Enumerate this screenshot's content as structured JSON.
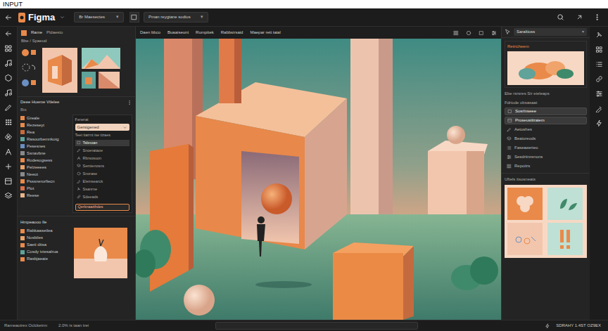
{
  "top_label": "INPUT",
  "title_bar": {
    "logo": "Figma",
    "file_menu": "Br Maesectes",
    "file_caret": "▾",
    "view_menu": "Pman reygtane sodius",
    "view_caret": "▾"
  },
  "canvas_toolbar": {
    "items": [
      "Daen bbco",
      "Buaaiseunt",
      "Rumpttek",
      "Rabbsirsaid",
      "Maepar rett taial"
    ]
  },
  "left_panel": {
    "header": {
      "title": "Rame",
      "subtitle": "Pldaesto"
    },
    "assets": {
      "label": "Bbe / Spaeud"
    },
    "layers": {
      "title": "Deee Hueme Vtlelee",
      "filter": "Bts",
      "items": [
        {
          "label": "Greale",
          "color": "#e98a4a"
        },
        {
          "label": "Rezeseyt",
          "color": "#e98a4a"
        },
        {
          "label": "Rea",
          "color": "#c86b3a"
        },
        {
          "label": "Rasourbemnkotg",
          "color": "#5fa39a"
        },
        {
          "label": "Pesesnes",
          "color": "#6b8fc2"
        },
        {
          "label": "Ssnavbne",
          "color": "#8a8a8a"
        },
        {
          "label": "Rodesogsess",
          "color": "#e98a4a"
        },
        {
          "label": "Pelzeeees",
          "color": "#e9a36a"
        },
        {
          "label": "Neeot",
          "color": "#8a8a8a"
        },
        {
          "label": "Psssnerorfiecn",
          "color": "#e98a4a"
        },
        {
          "label": "Plot",
          "color": "#d9704a"
        },
        {
          "label": "Reese",
          "color": "#e9b48a"
        }
      ]
    },
    "properties": {
      "title": "Fenerat",
      "dropdown": "Gersigened",
      "label": "Teet tiarrnt ise tizaes",
      "items": [
        {
          "label": "Tsbnoan",
          "selected": true
        },
        {
          "label": "Snoerataoe",
          "selected": false
        },
        {
          "label": "Rbrsosuon",
          "selected": false
        },
        {
          "label": "Semtenosns",
          "selected": false
        },
        {
          "label": "Snorase",
          "selected": false
        },
        {
          "label": "Elemsearck",
          "selected": false
        },
        {
          "label": "Ssanrne",
          "selected": false
        },
        {
          "label": "Sdeeads",
          "selected": false
        }
      ],
      "button": "Qerknaatthdes"
    },
    "pages": {
      "title": "Hmpeaooo Ile",
      "items": [
        {
          "label": "Rabkaasetlea",
          "color": "#e98a4a"
        },
        {
          "label": "Nosbiles",
          "color": "#e9a36a"
        },
        {
          "label": "Saeti ditsa",
          "color": "#e98a4a"
        },
        {
          "label": "Cosdy ivtesalrua",
          "color": "#5fa39a"
        },
        {
          "label": "Rasbjaeaie",
          "color": "#e98a4a"
        }
      ]
    }
  },
  "right_panel": {
    "dropdown": "Saraltioss",
    "dropdown_caret": "▾",
    "preview": {
      "title": "Retricheem"
    },
    "caption": "Ebe rsrsres Sir eieleaps",
    "group_label": "Fdriode obsasaat",
    "items": [
      {
        "label": "Sosrlnseee",
        "selected": true
      },
      {
        "label": "Proseustitraiem",
        "selected": true
      },
      {
        "label": "Aetoshes",
        "selected": false
      },
      {
        "label": "Beaioreods",
        "selected": false
      },
      {
        "label": "Faseaeerteo",
        "selected": false
      },
      {
        "label": "Sesdrtinrenons",
        "selected": false
      },
      {
        "label": "Repoitrs",
        "selected": false
      }
    ],
    "library": {
      "title": "Uftels itsosneats"
    }
  },
  "status_bar": {
    "left": "Rameaotrex Oclcketnn",
    "info": "2.0% is taan trei",
    "right": "SDRAHY 1.4ST OZ9EX"
  }
}
